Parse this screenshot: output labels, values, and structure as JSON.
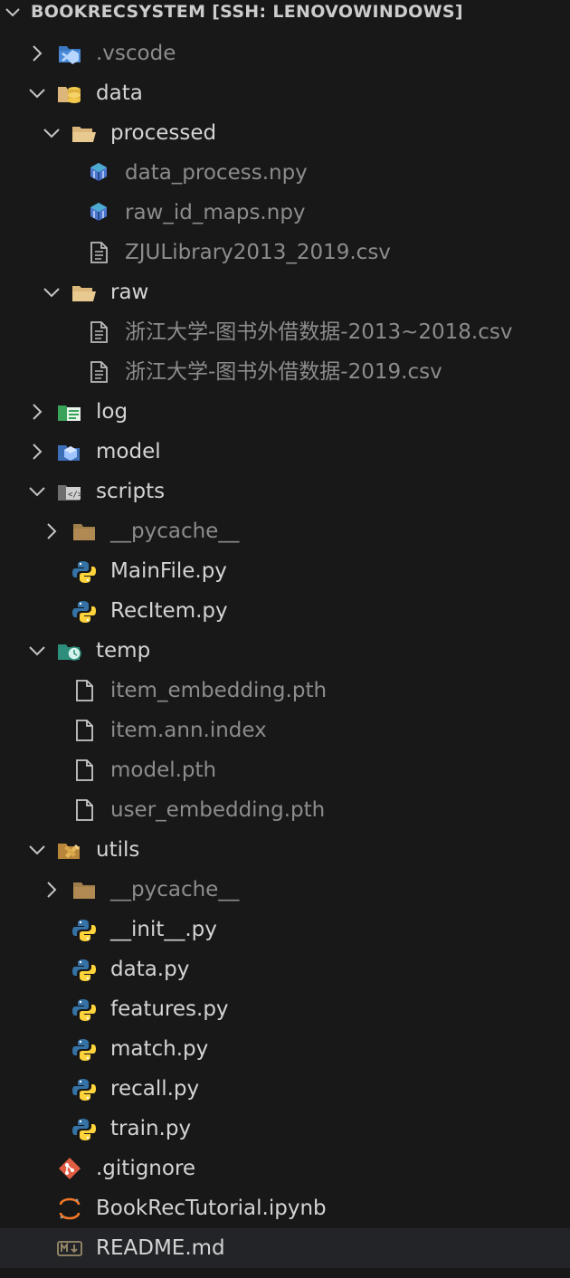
{
  "explorer": {
    "title": "BOOKRECSYSTEM [SSH: LENOVOWINDOWS]",
    "items": [
      {
        "label": ".vscode",
        "depth": 1,
        "kind": "folder",
        "state": "collapsed",
        "icon": "vscode-folder-icon",
        "dim": true
      },
      {
        "label": "data",
        "depth": 1,
        "kind": "folder",
        "state": "expanded",
        "icon": "data-folder-icon",
        "dim": false
      },
      {
        "label": "processed",
        "depth": 2,
        "kind": "folder",
        "state": "expanded",
        "icon": "folder-open-icon",
        "dim": false
      },
      {
        "label": "data_process.npy",
        "depth": 3,
        "kind": "file",
        "icon": "numpy-file-icon",
        "dim": true
      },
      {
        "label": "raw_id_maps.npy",
        "depth": 3,
        "kind": "file",
        "icon": "numpy-file-icon",
        "dim": true
      },
      {
        "label": "ZJULibrary2013_2019.csv",
        "depth": 3,
        "kind": "file",
        "icon": "text-file-icon",
        "dim": true
      },
      {
        "label": "raw",
        "depth": 2,
        "kind": "folder",
        "state": "expanded",
        "icon": "folder-open-icon",
        "dim": false
      },
      {
        "label": "浙江大学-图书外借数据-2013~2018.csv",
        "depth": 3,
        "kind": "file",
        "icon": "text-file-icon",
        "dim": true
      },
      {
        "label": "浙江大学-图书外借数据-2019.csv",
        "depth": 3,
        "kind": "file",
        "icon": "text-file-icon",
        "dim": true
      },
      {
        "label": "log",
        "depth": 1,
        "kind": "folder",
        "state": "collapsed",
        "icon": "log-folder-icon",
        "dim": false
      },
      {
        "label": "model",
        "depth": 1,
        "kind": "folder",
        "state": "collapsed",
        "icon": "model-folder-icon",
        "dim": false
      },
      {
        "label": "scripts",
        "depth": 1,
        "kind": "folder",
        "state": "expanded",
        "icon": "scripts-folder-icon",
        "dim": false
      },
      {
        "label": "__pycache__",
        "depth": 2,
        "kind": "folder",
        "state": "collapsed",
        "icon": "folder-icon",
        "dim": true
      },
      {
        "label": "MainFile.py",
        "depth": 2,
        "kind": "file",
        "icon": "python-file-icon",
        "dim": false
      },
      {
        "label": "RecItem.py",
        "depth": 2,
        "kind": "file",
        "icon": "python-file-icon",
        "dim": false
      },
      {
        "label": "temp",
        "depth": 1,
        "kind": "folder",
        "state": "expanded",
        "icon": "temp-folder-icon",
        "dim": false
      },
      {
        "label": "item_embedding.pth",
        "depth": 2,
        "kind": "file",
        "icon": "blank-file-icon",
        "dim": true
      },
      {
        "label": "item.ann.index",
        "depth": 2,
        "kind": "file",
        "icon": "blank-file-icon",
        "dim": true
      },
      {
        "label": "model.pth",
        "depth": 2,
        "kind": "file",
        "icon": "blank-file-icon",
        "dim": true
      },
      {
        "label": "user_embedding.pth",
        "depth": 2,
        "kind": "file",
        "icon": "blank-file-icon",
        "dim": true
      },
      {
        "label": "utils",
        "depth": 1,
        "kind": "folder",
        "state": "expanded",
        "icon": "utils-folder-icon",
        "dim": false
      },
      {
        "label": "__pycache__",
        "depth": 2,
        "kind": "folder",
        "state": "collapsed",
        "icon": "folder-icon",
        "dim": true
      },
      {
        "label": "__init__.py",
        "depth": 2,
        "kind": "file",
        "icon": "python-file-icon",
        "dim": false
      },
      {
        "label": "data.py",
        "depth": 2,
        "kind": "file",
        "icon": "python-file-icon",
        "dim": false
      },
      {
        "label": "features.py",
        "depth": 2,
        "kind": "file",
        "icon": "python-file-icon",
        "dim": false
      },
      {
        "label": "match.py",
        "depth": 2,
        "kind": "file",
        "icon": "python-file-icon",
        "dim": false
      },
      {
        "label": "recall.py",
        "depth": 2,
        "kind": "file",
        "icon": "python-file-icon",
        "dim": false
      },
      {
        "label": "train.py",
        "depth": 2,
        "kind": "file",
        "icon": "python-file-icon",
        "dim": false
      },
      {
        "label": ".gitignore",
        "depth": 1,
        "kind": "file",
        "icon": "git-file-icon",
        "dim": false
      },
      {
        "label": "BookRecTutorial.ipynb",
        "depth": 1,
        "kind": "file",
        "icon": "jupyter-file-icon",
        "dim": false
      },
      {
        "label": "README.md",
        "depth": 1,
        "kind": "file",
        "icon": "markdown-file-icon",
        "dim": false,
        "selected": true
      }
    ]
  },
  "colors": {
    "background": "#181818",
    "text": "#d4d4d4",
    "dim_text": "#8c8c8c",
    "folder": "#dcb67a",
    "python_blue": "#3572a5",
    "python_yellow": "#ffd43b",
    "selected_row": "#222428"
  }
}
